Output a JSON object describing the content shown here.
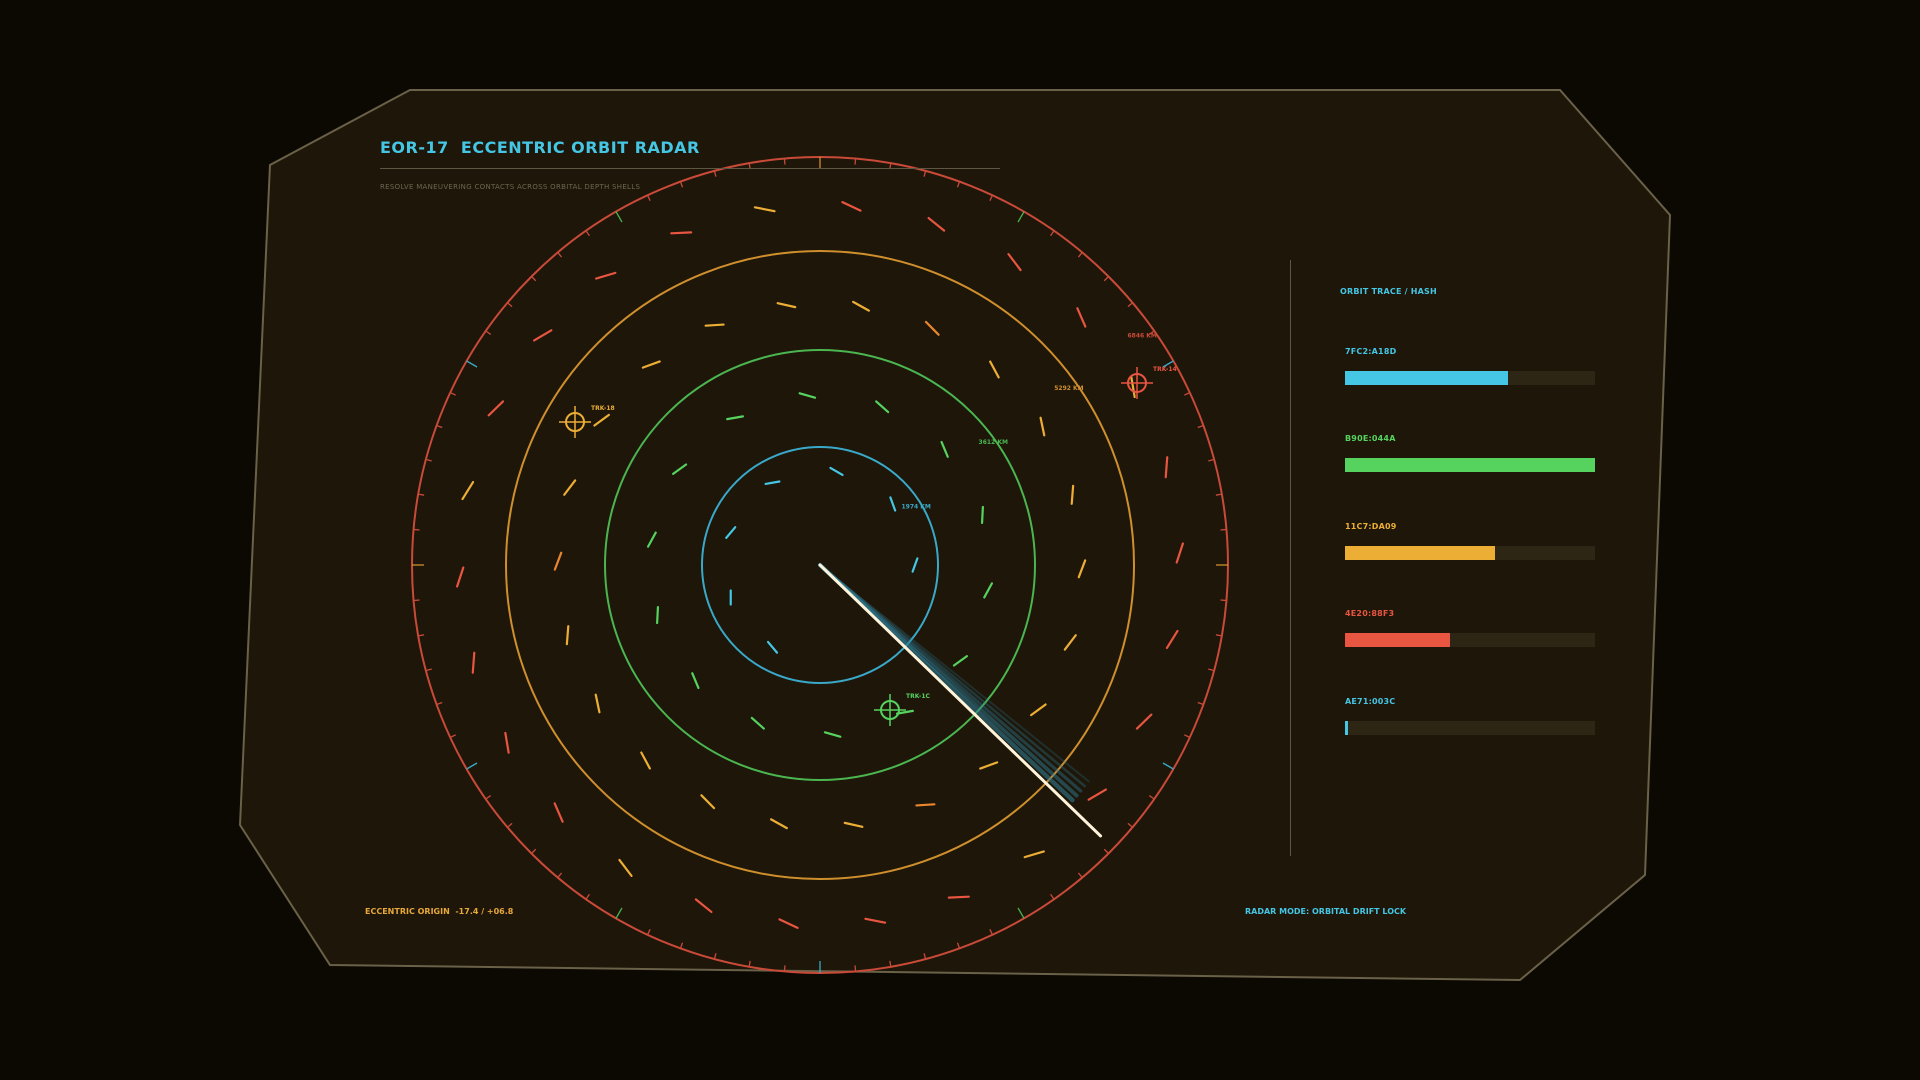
{
  "header": {
    "title": "EOR-17  ECCENTRIC ORBIT RADAR",
    "subtitle": "RESOLVE MANEUVERING CONTACTS ACROSS ORBITAL DEPTH SHELLS"
  },
  "colors": {
    "cyan": "#45c6e4",
    "green": "#56d35e",
    "amber": "#ecae35",
    "red": "#e85540",
    "frame": "#6a6148",
    "panel": "#1d1609"
  },
  "radar": {
    "rings": [
      {
        "label": "1974 KM",
        "color": "#3aa9c9"
      },
      {
        "label": "3612 KM",
        "color": "#4bb650"
      },
      {
        "label": "5292 KM",
        "color": "#cf8f2c"
      },
      {
        "label": "6846 KM",
        "color": "#c94a38"
      }
    ],
    "targets": [
      {
        "label": "TRK-18",
        "color": "#ecae35"
      },
      {
        "label": "TRK-14",
        "color": "#e85540"
      },
      {
        "label": "TRK-1C",
        "color": "#56d35e"
      }
    ],
    "sweep_heading_deg": 134
  },
  "trace": {
    "title": "ORBIT TRACE / HASH",
    "items": [
      {
        "label": "7FC2:A18D",
        "color": "#45c6e4",
        "value": 0.65
      },
      {
        "label": "B90E:044A",
        "color": "#56d35e",
        "value": 1.0
      },
      {
        "label": "11C7:DA09",
        "color": "#ecae35",
        "value": 0.6
      },
      {
        "label": "4E20:88F3",
        "color": "#e85540",
        "value": 0.42
      },
      {
        "label": "AE71:003C",
        "color": "#45c6e4",
        "value": 0.01
      }
    ]
  },
  "footer": {
    "origin": "ECCENTRIC ORIGIN  -17.4 / +06.8",
    "mode": "RADAR MODE: ORBITAL DRIFT LOCK"
  }
}
